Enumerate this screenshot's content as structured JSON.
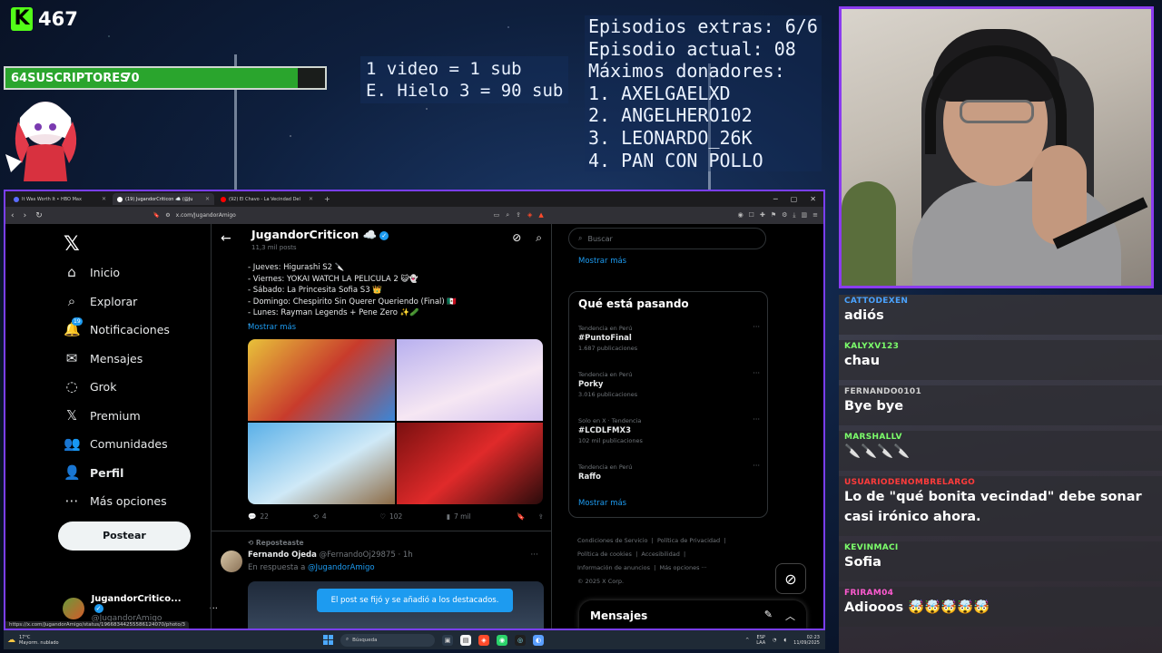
{
  "overlay": {
    "kick_count": "467",
    "sub_goal": {
      "current": "64",
      "label": "SUSCRIPTORES",
      "target": "70",
      "progress": 0.914
    },
    "rules": [
      "1 video = 1 sub",
      "E. Hielo 3 = 90 sub"
    ],
    "info": [
      "Episodios extras: 6/6",
      "Episodio actual: 08",
      "Máximos donadores:",
      "1. AXELGAELXD",
      "2. ANGELHERO102",
      "3. LEONARDO_26K",
      "4. PAN CON POLLO"
    ]
  },
  "chat": {
    "messages": [
      {
        "user": "CATTODEXEN",
        "user_color": "#4aa3ff",
        "text": "adiós"
      },
      {
        "user": "KALYXV123",
        "user_color": "#7cff6b",
        "text": "chau"
      },
      {
        "user": "FERNANDO0101",
        "user_color": "#cfcfcf",
        "text": "Bye bye"
      },
      {
        "user": "MARSHALLV",
        "user_color": "#7cff6b",
        "text": "🔪🔪🔪🔪"
      },
      {
        "user": "USUARIODENOMBRELARGO",
        "user_color": "#ff3b3b",
        "text": "Lo de \"qué bonita vecindad\" debe sonar casi irónico ahora."
      },
      {
        "user": "KEVINMACI",
        "user_color": "#7cff6b",
        "text": "Sofia"
      },
      {
        "user": "FRIRAM04",
        "user_color": "#ff5ad1",
        "text": "Adiooos 🤯🤯🤯🤯🤯"
      }
    ]
  },
  "browser": {
    "tabs": [
      {
        "title": "It Was Worth It • HBO Max",
        "fav_color": "#5b6cff"
      },
      {
        "title": "(19) JugandorCriticon ☁️ (@Ju",
        "fav_color": "#ffffff"
      },
      {
        "title": "(92) El Chavo - La Vecindad Del",
        "fav_color": "#ff0000"
      }
    ],
    "url": "x.com/JugandorAmigo",
    "status_url": "https://x.com/JugandorAmigo/status/1966834425558612407​0/photo/3"
  },
  "x": {
    "nav": [
      {
        "label": "Inicio",
        "icon": "⌂"
      },
      {
        "label": "Explorar",
        "icon": "⌕"
      },
      {
        "label": "Notificaciones",
        "icon": "🔔",
        "badge": "19"
      },
      {
        "label": "Mensajes",
        "icon": "✉"
      },
      {
        "label": "Grok",
        "icon": "◌"
      },
      {
        "label": "Premium",
        "icon": "𝕏"
      },
      {
        "label": "Comunidades",
        "icon": "👥"
      },
      {
        "label": "Perfil",
        "icon": "👤"
      },
      {
        "label": "Más opciones",
        "icon": "⋯"
      }
    ],
    "post_button": "Postear",
    "me": {
      "name": "JugandorCritico...",
      "handle": "@JugandorAmigo"
    },
    "profile": {
      "name": "JugandorCriticon ☁️",
      "posts": "11,3 mil posts"
    },
    "schedule": [
      "- Jueves: Higurashi S2 🔪",
      "- Viernes: YOKAI WATCH LA PELICULA 2 😺👻",
      "- Sábado: La Princesita Sofia S3 👑",
      "- Domingo: Chespirito Sin Querer Queriendo (Final) 🇲🇽",
      "- Lunes: Rayman Legends + Pene Zero ✨🥒",
      "-"
    ],
    "show_more": "Mostrar más",
    "actions": {
      "replies": "22",
      "reposts": "4",
      "likes": "102",
      "views": "7 mil"
    },
    "reposted": "Reposteaste",
    "reply": {
      "name": "Fernando Ojeda",
      "handle": "@FernandoOj29875",
      "time": "· 1h",
      "in_reply": "En respuesta a",
      "reply_to": "@JugandorAmigo"
    },
    "toast": "El post se fijó y se añadió a los destacados.",
    "search_placeholder": "Buscar",
    "trends_title": "Qué está pasando",
    "trends": [
      {
        "context": "Tendencia en Perú",
        "name": "#PuntoFinal",
        "count": "1.687 publicaciones"
      },
      {
        "context": "Tendencia en Perú",
        "name": "Porky",
        "count": "3.016 publicaciones"
      },
      {
        "context": "Solo en X · Tendencia",
        "name": "#LCDLFMX3",
        "count": "102 mil publicaciones"
      },
      {
        "context": "Tendencia en Perú",
        "name": "Raffo",
        "count": ""
      }
    ],
    "footer": [
      "Condiciones de Servicio",
      "Política de Privacidad",
      "Política de cookies",
      "Accesibilidad",
      "Información de anuncios",
      "Más opciones ···",
      "© 2025 X Corp."
    ],
    "messages_title": "Mensajes"
  },
  "taskbar": {
    "temp": "17°C",
    "weather": "Mayorm. nublado",
    "search": "Búsqueda",
    "lang": "ESP",
    "lang2": "LAA",
    "time": "02:23",
    "date": "11/09/2025"
  }
}
